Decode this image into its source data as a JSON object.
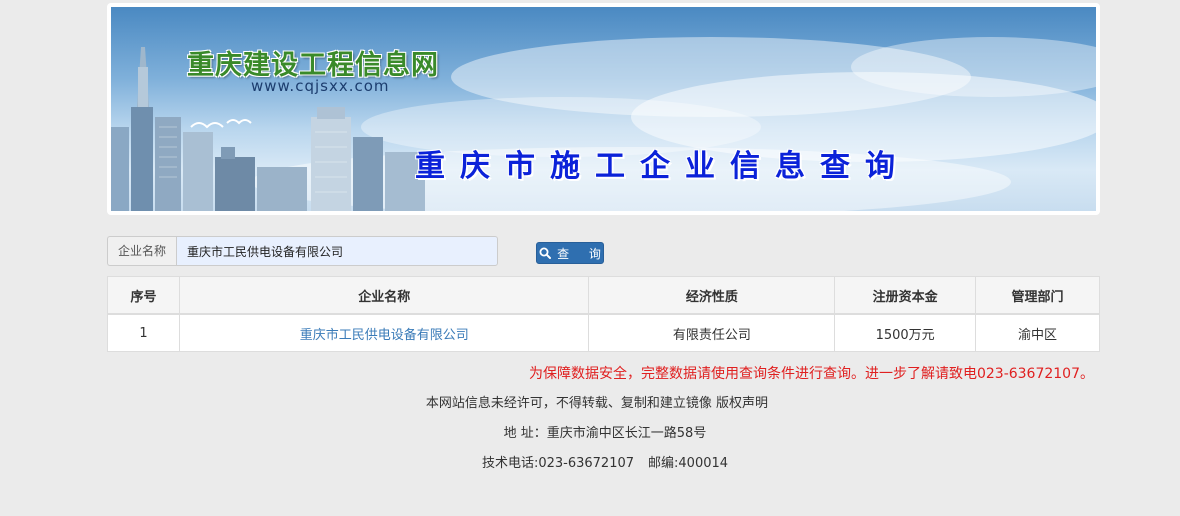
{
  "banner": {
    "site_name": "重庆建设工程信息网",
    "site_url": "www.cqjsxx.com",
    "title": "重庆市施工企业信息查询"
  },
  "search": {
    "label": "企业名称",
    "value": "重庆市工民供电设备有限公司",
    "button_label": "查 询",
    "button_icon": "search-icon"
  },
  "table": {
    "headers": [
      "序号",
      "企业名称",
      "经济性质",
      "注册资本金",
      "管理部门"
    ],
    "rows": [
      {
        "index": "1",
        "name": "重庆市工民供电设备有限公司",
        "nature": "有限责任公司",
        "capital": "1500万元",
        "department": "渝中区"
      }
    ]
  },
  "footer": {
    "warning": "为保障数据安全，完整数据请使用查询条件进行查询。进一步了解请致电023-63672107。",
    "copyright": "本网站信息未经许可，不得转载、复制和建立镜像 版权声明",
    "address": "地 址：重庆市渝中区长江一路58号",
    "phone": "技术电话:023-63672107",
    "postcode": "邮编:400014"
  },
  "colors": {
    "accent": "#2f6fb0",
    "warning": "#e02020",
    "link": "#3a7bb8",
    "title": "#0b22d9",
    "logo": "#3a8a2a"
  }
}
